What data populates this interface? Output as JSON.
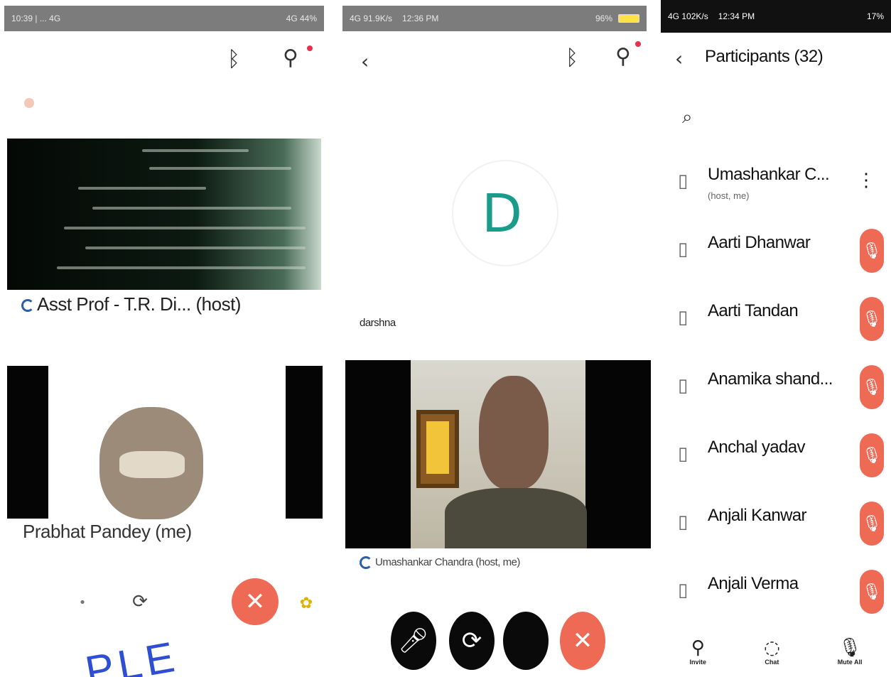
{
  "panel_left": {
    "status_left": "10:39 | ... 4G",
    "status_right": "4G 44%",
    "host_caption": "Asst Prof - T.R. Di... (host)",
    "self_caption": "Prabhat Pandey (me)",
    "buttons": {
      "leave_icon": "✕"
    },
    "stamp_text": "PLE"
  },
  "panel_middle": {
    "status_left": "4G 91.9K/s",
    "status_time": "12:36 PM",
    "status_right": "96%",
    "avatar_letter": "D",
    "avatar_name": "darshna",
    "host_caption": "Umashankar Chandra (host, me)",
    "buttons": {
      "leave_icon": "✕"
    }
  },
  "panel_right": {
    "status_left": "4G 102K/s",
    "status_time": "12:34 PM",
    "status_right": "17%",
    "title": "Participants (32)",
    "participants": [
      {
        "name": "Umashankar C...",
        "sub": "(host, me)",
        "muted": false
      },
      {
        "name": "Aarti Dhanwar",
        "muted": true
      },
      {
        "name": "Aarti Tandan",
        "muted": true
      },
      {
        "name": "Anamika shand...",
        "muted": true
      },
      {
        "name": "Anchal yadav",
        "muted": true
      },
      {
        "name": "Anjali Kanwar",
        "muted": true
      },
      {
        "name": "Anjali Verma",
        "muted": true
      }
    ],
    "bottom": [
      {
        "label": "Invite",
        "icon": "person-add-icon"
      },
      {
        "label": "Chat",
        "icon": "chat-icon"
      },
      {
        "label": "Mute All",
        "icon": "mic-icon"
      }
    ]
  },
  "colors": {
    "leave": "#ee6a55",
    "avatar_letter": "#1a9c8a",
    "stamp": "#2e4fd3"
  }
}
